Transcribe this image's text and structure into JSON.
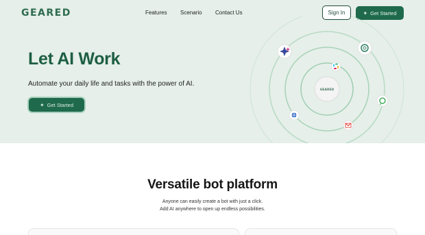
{
  "header": {
    "logo": "GEARED",
    "nav": [
      "Features",
      "Scenario",
      "Contact Us"
    ],
    "sign_in": "Sign In",
    "get_started": "Get Started"
  },
  "hero": {
    "title": "Let AI Work",
    "subtitle": "Automate your daily life and tasks with the power of AI.",
    "cta": "Get Started",
    "center_logo": "GEARED"
  },
  "section": {
    "title": "Versatile bot platform",
    "line1": "Anyone can easily create a bot with just a click.",
    "line2": "Add AI anywhere to open up endless possibilities."
  },
  "icons": [
    "sparkle-icon",
    "openai-icon",
    "slack-icon",
    "whatsapp-icon",
    "gmail-icon",
    "calendar-icon"
  ],
  "colors": {
    "brand": "#1f6a4c",
    "hero_bg": "#e6efe9",
    "logo": "#2e6b4f"
  }
}
